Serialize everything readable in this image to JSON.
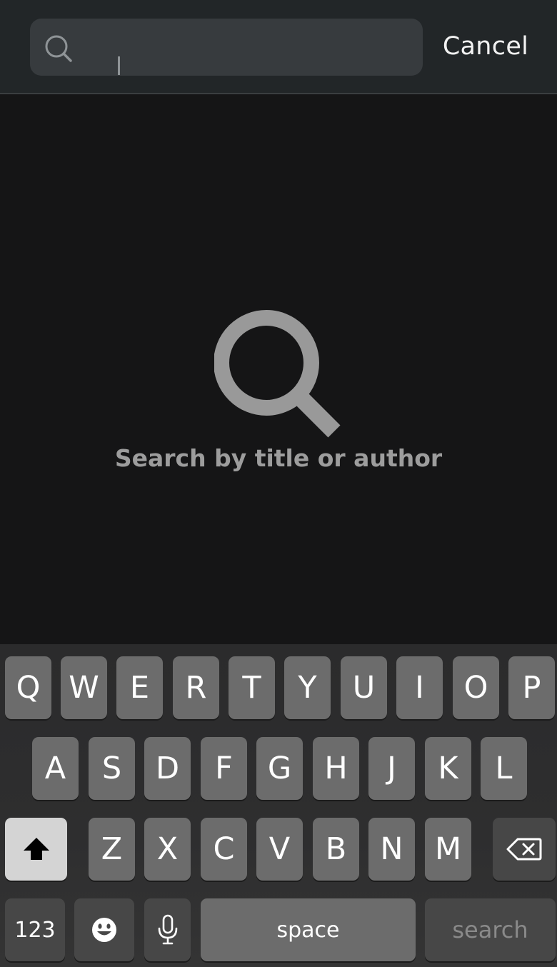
{
  "search": {
    "placeholder": "",
    "value": "",
    "cancel_label": "Cancel"
  },
  "empty_state": {
    "icon": "magnifying-glass-icon",
    "message": "Search by title or author"
  },
  "keyboard": {
    "row1": [
      "Q",
      "W",
      "E",
      "R",
      "T",
      "Y",
      "U",
      "I",
      "O",
      "P"
    ],
    "row2": [
      "A",
      "S",
      "D",
      "F",
      "G",
      "H",
      "J",
      "K",
      "L"
    ],
    "row3": [
      "Z",
      "X",
      "C",
      "V",
      "B",
      "N",
      "M"
    ],
    "shift_icon": "shift-arrow-icon",
    "delete_icon": "backspace-icon",
    "numbers_label": "123",
    "emoji_icon": "emoji-icon",
    "mic_icon": "microphone-icon",
    "space_label": "space",
    "return_label": "search"
  },
  "colors": {
    "background": "#151516",
    "header": "#222628",
    "search_field": "#373b3e",
    "key": "#6c6c6c",
    "key_dark": "#474747",
    "key_active": "#d4d4d4",
    "muted_text": "#9d9d9d"
  }
}
